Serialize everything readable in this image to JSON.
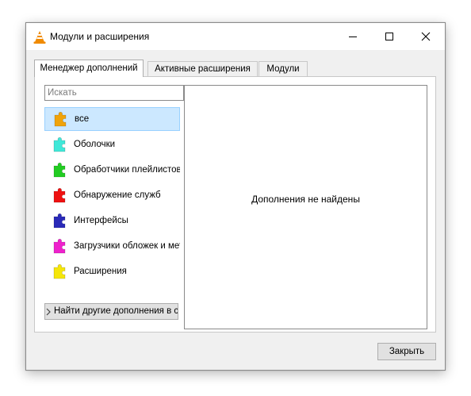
{
  "window": {
    "title": "Модули и расширения",
    "app_icon": "vlc-cone-icon",
    "controls": [
      "minimize-icon",
      "maximize-icon",
      "close-icon"
    ]
  },
  "tabs": [
    {
      "label": "Менеджер дополнений",
      "active": true
    },
    {
      "label": "Активные расширения",
      "active": false
    },
    {
      "label": "Модули",
      "active": false
    }
  ],
  "search": {
    "placeholder": "Искать",
    "value": ""
  },
  "categories": [
    {
      "label": "все",
      "icon": "puzzle-icon",
      "color": "#f0a30a",
      "selected": true
    },
    {
      "label": "Оболочки",
      "icon": "puzzle-icon",
      "color": "#40e8d8",
      "selected": false
    },
    {
      "label": "Обработчики плейлистов",
      "icon": "puzzle-icon",
      "color": "#22cc22",
      "selected": false
    },
    {
      "label": "Обнаружение служб",
      "icon": "puzzle-icon",
      "color": "#ee1111",
      "selected": false
    },
    {
      "label": "Интерфейсы",
      "icon": "puzzle-icon",
      "color": "#2a2ab8",
      "selected": false
    },
    {
      "label": "Загрузчики обложек и мет",
      "icon": "puzzle-icon",
      "color": "#ee22cc",
      "selected": false
    },
    {
      "label": "Расширения",
      "icon": "puzzle-icon",
      "color": "#f5e60a",
      "selected": false
    }
  ],
  "find_more": {
    "label": "Найти другие дополнения в се"
  },
  "content": {
    "empty_message": "Дополнения не найдены"
  },
  "footer": {
    "close_label": "Закрыть"
  },
  "colors": {
    "selection": "#cce8ff",
    "selection_border": "#99d1ff",
    "window_bg": "#f0f0f0"
  }
}
